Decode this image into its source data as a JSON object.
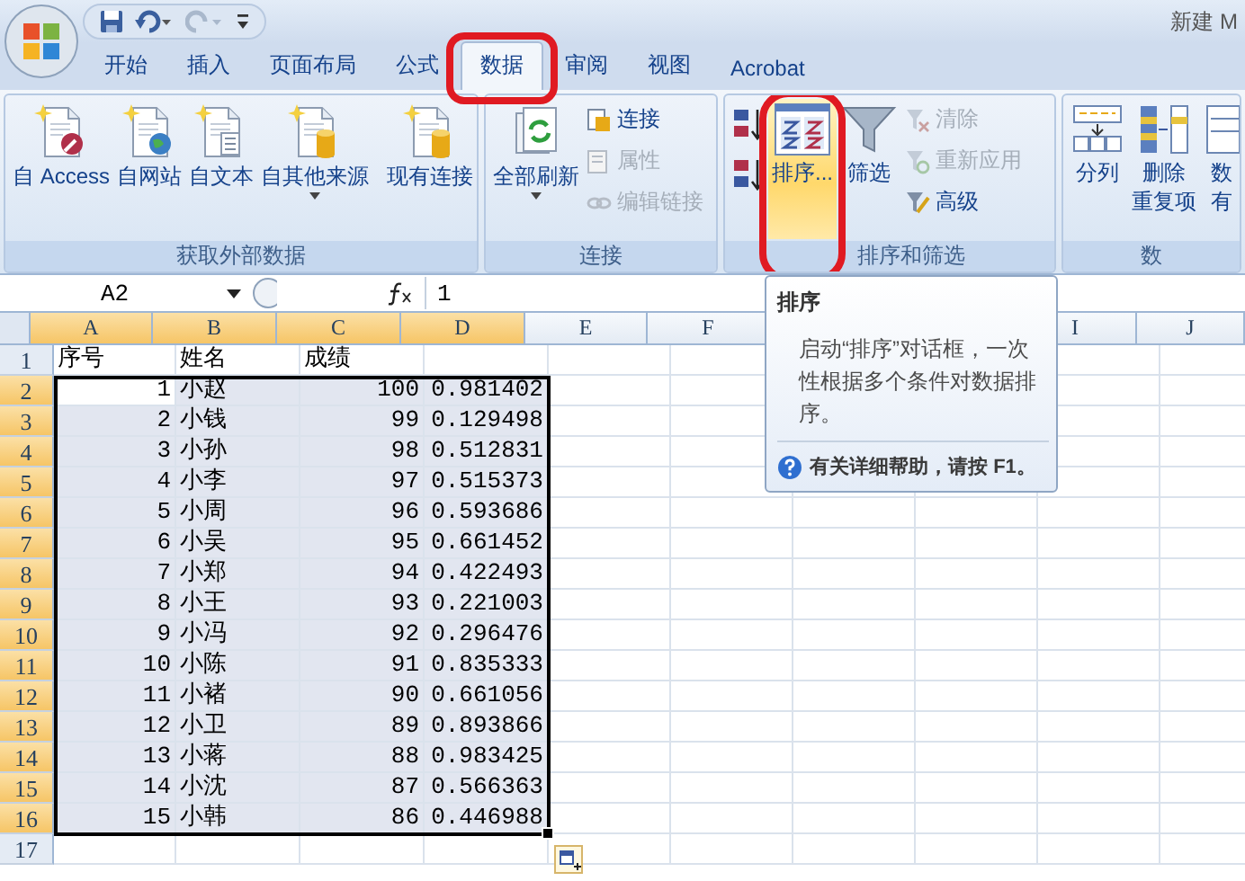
{
  "title_bar": {
    "title": "新建 M"
  },
  "tabs": [
    {
      "label": "开始",
      "selected": false,
      "highlighted": false
    },
    {
      "label": "插入",
      "selected": false,
      "highlighted": false
    },
    {
      "label": "页面布局",
      "selected": false,
      "highlighted": false
    },
    {
      "label": "公式",
      "selected": false,
      "highlighted": false
    },
    {
      "label": "数据",
      "selected": true,
      "highlighted": true
    },
    {
      "label": "审阅",
      "selected": false,
      "highlighted": false
    },
    {
      "label": "视图",
      "selected": false,
      "highlighted": false
    },
    {
      "label": "Acrobat",
      "selected": false,
      "highlighted": false
    }
  ],
  "ribbon": {
    "groups": [
      {
        "label": "获取外部数据",
        "items": [
          {
            "kind": "large",
            "label": "自 Access"
          },
          {
            "kind": "large",
            "label": "自网站"
          },
          {
            "kind": "large",
            "label": "自文本"
          },
          {
            "kind": "large",
            "label": "自其他来源",
            "dropdown": true
          },
          {
            "kind": "separator"
          },
          {
            "kind": "large",
            "label": "现有连接"
          }
        ]
      },
      {
        "label": "连接",
        "items": [
          {
            "kind": "large",
            "label": "全部刷新",
            "dropdown": true
          },
          {
            "kind": "stack",
            "items": [
              {
                "label": "连接",
                "disabled": false
              },
              {
                "label": "属性",
                "disabled": true
              },
              {
                "label": "编辑链接",
                "disabled": true
              }
            ]
          }
        ]
      },
      {
        "label": "排序和筛选",
        "items": [
          {
            "kind": "sort-pair"
          },
          {
            "kind": "large",
            "label": "排序...",
            "highlighted": true,
            "hovered": true
          },
          {
            "kind": "large",
            "label": "筛选"
          },
          {
            "kind": "stack",
            "items": [
              {
                "label": "清除",
                "disabled": true
              },
              {
                "label": "重新应用",
                "disabled": true
              },
              {
                "label": "高级",
                "disabled": false
              }
            ]
          }
        ]
      },
      {
        "label": "数",
        "items": [
          {
            "kind": "large",
            "label": "分列"
          },
          {
            "kind": "large",
            "label": "删除",
            "label2": "重复项"
          },
          {
            "kind": "large",
            "label": "数",
            "label2": "有"
          }
        ]
      }
    ]
  },
  "formula_bar": {
    "name_box": "A2",
    "value": "1"
  },
  "columns": [
    {
      "label": "A",
      "selected": true
    },
    {
      "label": "B",
      "selected": true
    },
    {
      "label": "C",
      "selected": true
    },
    {
      "label": "D",
      "selected": true
    },
    {
      "label": "E",
      "selected": false
    },
    {
      "label": "F",
      "selected": false
    },
    null,
    null,
    {
      "label": "I",
      "selected": false
    },
    {
      "label": "J",
      "selected": false
    }
  ],
  "rows": [
    {
      "header": "1",
      "selected": false,
      "kind": "heading",
      "cells": [
        "序号",
        "姓名",
        "成绩"
      ]
    },
    {
      "header": "2",
      "selected": true,
      "kind": "data",
      "cells": [
        "1",
        "小赵",
        "100",
        "0.981402"
      ]
    },
    {
      "header": "3",
      "selected": true,
      "kind": "data",
      "cells": [
        "2",
        "小钱",
        "99",
        "0.129498"
      ]
    },
    {
      "header": "4",
      "selected": true,
      "kind": "data",
      "cells": [
        "3",
        "小孙",
        "98",
        "0.512831"
      ]
    },
    {
      "header": "5",
      "selected": true,
      "kind": "data",
      "cells": [
        "4",
        "小李",
        "97",
        "0.515373"
      ]
    },
    {
      "header": "6",
      "selected": true,
      "kind": "data",
      "cells": [
        "5",
        "小周",
        "96",
        "0.593686"
      ]
    },
    {
      "header": "7",
      "selected": true,
      "kind": "data",
      "cells": [
        "6",
        "小吴",
        "95",
        "0.661452"
      ]
    },
    {
      "header": "8",
      "selected": true,
      "kind": "data",
      "cells": [
        "7",
        "小郑",
        "94",
        "0.422493"
      ]
    },
    {
      "header": "9",
      "selected": true,
      "kind": "data",
      "cells": [
        "8",
        "小王",
        "93",
        "0.221003"
      ]
    },
    {
      "header": "10",
      "selected": true,
      "kind": "data",
      "cells": [
        "9",
        "小冯",
        "92",
        "0.296476"
      ]
    },
    {
      "header": "11",
      "selected": true,
      "kind": "data",
      "cells": [
        "10",
        "小陈",
        "91",
        "0.835333"
      ]
    },
    {
      "header": "12",
      "selected": true,
      "kind": "data",
      "cells": [
        "11",
        "小褚",
        "90",
        "0.661056"
      ]
    },
    {
      "header": "13",
      "selected": true,
      "kind": "data",
      "cells": [
        "12",
        "小卫",
        "89",
        "0.893866"
      ]
    },
    {
      "header": "14",
      "selected": true,
      "kind": "data",
      "cells": [
        "13",
        "小蒋",
        "88",
        "0.983425"
      ]
    },
    {
      "header": "15",
      "selected": true,
      "kind": "data",
      "cells": [
        "14",
        "小沈",
        "87",
        "0.566363"
      ]
    },
    {
      "header": "16",
      "selected": true,
      "kind": "data",
      "cells": [
        "15",
        "小韩",
        "86",
        "0.446988"
      ]
    },
    {
      "header": "17",
      "selected": false,
      "kind": "empty",
      "cells": []
    }
  ],
  "tooltip": {
    "title": "排序",
    "body": "启动“排序”对话框，一次性根据多个条件对数据排序。",
    "help": "有关详细帮助，请按 **F1**。"
  }
}
